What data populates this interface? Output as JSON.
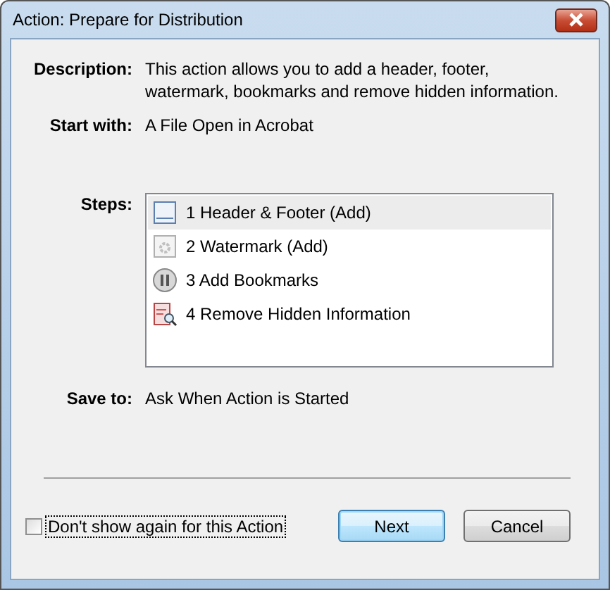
{
  "window": {
    "title": "Action: Prepare for Distribution"
  },
  "fields": [
    {
      "label": "Description:",
      "value": "This action allows you to add a header, footer, watermark, bookmarks and remove hidden information."
    },
    {
      "label": "Start with:",
      "value": "A File Open in Acrobat"
    }
  ],
  "steps": {
    "label": "Steps:",
    "items": [
      {
        "kind": "header-footer",
        "text": "1  Header & Footer (Add)",
        "selected": true
      },
      {
        "kind": "watermark",
        "text": "2  Watermark (Add)",
        "selected": false
      },
      {
        "kind": "bookmarks",
        "text": "3  Add Bookmarks",
        "selected": false
      },
      {
        "kind": "remove-info",
        "text": "4  Remove Hidden Information",
        "selected": false
      }
    ]
  },
  "save_to": {
    "label": "Save to:",
    "value": "Ask When Action is Started"
  },
  "dont_show": {
    "label": "Don't show again for this Action",
    "checked": false
  },
  "buttons": [
    {
      "label": "Next",
      "selected": true
    },
    {
      "label": "Cancel",
      "selected": false
    }
  ]
}
